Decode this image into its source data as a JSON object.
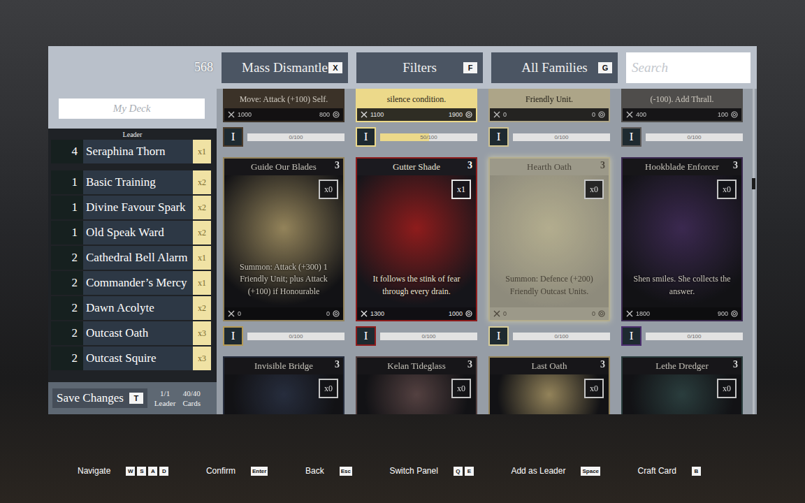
{
  "top_bar": {
    "currency": "568",
    "buttons": [
      {
        "label": "Mass Dismantle",
        "key": "X"
      },
      {
        "label": "Filters",
        "key": "F"
      },
      {
        "label": "All Families",
        "key": "G"
      }
    ],
    "search": {
      "placeholder": "Search"
    }
  },
  "deck": {
    "name_placeholder": "My Deck",
    "leader_label": "Leader",
    "leader": {
      "cost": "4",
      "name": "Seraphina Thorn",
      "count": "x1"
    },
    "cards": [
      {
        "cost": "1",
        "name": "Basic Training",
        "count": "x2"
      },
      {
        "cost": "1",
        "name": "Divine Favour Spark",
        "count": "x2"
      },
      {
        "cost": "1",
        "name": "Old Speak Ward",
        "count": "x2"
      },
      {
        "cost": "2",
        "name": "Cathedral Bell Alarm",
        "count": "x1"
      },
      {
        "cost": "2",
        "name": "Commander’s Mercy",
        "count": "x1"
      },
      {
        "cost": "2",
        "name": "Dawn Acolyte",
        "count": "x2"
      },
      {
        "cost": "2",
        "name": "Outcast Oath",
        "count": "x3"
      },
      {
        "cost": "2",
        "name": "Outcast Squire",
        "count": "x3"
      }
    ],
    "save": {
      "label": "Save Changes",
      "key": "T"
    },
    "leader_count": {
      "value": "1/1",
      "label": "Leader"
    },
    "card_count": {
      "value": "40/40",
      "label": "Cards"
    }
  },
  "cards": [
    {
      "kind": "partial",
      "text": "Move: Attack (+100) Self.",
      "attack": "1000",
      "defence": "800",
      "color": "#4a3a2a",
      "owned": false,
      "selected": false,
      "rank": "I",
      "progress": "0/100",
      "level": 0
    },
    {
      "kind": "partial",
      "text": "silence condition.",
      "attack": "1100",
      "defence": "1900",
      "color": "#ecd98a",
      "owned": true,
      "selected": false,
      "rank": "I",
      "progress": "50/100",
      "level": 0.5
    },
    {
      "kind": "partial",
      "text": "Friendly Unit.",
      "attack": "0",
      "defence": "0",
      "color": "#cfc391",
      "owned": false,
      "selected": false,
      "rank": "I",
      "progress": "0/100",
      "level": 0
    },
    {
      "kind": "partial",
      "text": "(-100). Add Thrall.",
      "attack": "400",
      "defence": "100",
      "color": "#5e5a58",
      "owned": false,
      "selected": false,
      "rank": "I",
      "progress": "0/100",
      "level": 0
    },
    {
      "kind": "full",
      "name": "Guide Our Blades",
      "cost": "3",
      "count": "x0",
      "text": "Summon: Attack (+300) 1 Friendly Unit; plus Attack (+100) if Honourable",
      "attack": "0",
      "defence": "0",
      "color": "#b59a55",
      "owned": false,
      "selected": false,
      "rank": "I",
      "progress": "0/100",
      "level": 0
    },
    {
      "kind": "full",
      "name": "Gutter Shade",
      "cost": "3",
      "count": "x1",
      "text": "It follows the stink of fear through every drain.",
      "attack": "1300",
      "defence": "1000",
      "color": "#8e1c1c",
      "owned": true,
      "selected": false,
      "rank": "I",
      "progress": "0/100",
      "level": 0
    },
    {
      "kind": "full",
      "name": "Hearth Oath",
      "cost": "3",
      "count": "x0",
      "text": "Summon: Defence (+200) Friendly Outcast Units.",
      "attack": "0",
      "defence": "0",
      "color": "#d6cc98",
      "owned": false,
      "selected": true,
      "rank": "I",
      "progress": "0/100",
      "level": 0
    },
    {
      "kind": "full",
      "name": "Hookblade Enforcer",
      "cost": "3",
      "count": "x0",
      "text": "Shen smiles. She collects the answer.",
      "attack": "1800",
      "defence": "900",
      "color": "#4b2d6e",
      "owned": false,
      "selected": false,
      "rank": "I",
      "progress": "0/100",
      "level": 0
    },
    {
      "kind": "top",
      "name": "Invisible Bridge",
      "cost": "3",
      "count": "x0",
      "color": "#2a3550",
      "owned": false,
      "selected": false
    },
    {
      "kind": "top",
      "name": "Kelan Tideglass",
      "cost": "3",
      "count": "x0",
      "color": "#6a4a4a",
      "owned": false,
      "selected": false
    },
    {
      "kind": "top",
      "name": "Last Oath",
      "cost": "3",
      "count": "x0",
      "color": "#b59a55",
      "owned": false,
      "selected": false
    },
    {
      "kind": "top",
      "name": "Lethe Dredger",
      "cost": "3",
      "count": "x0",
      "color": "#2a4a4a",
      "owned": false,
      "selected": false
    }
  ],
  "hints": [
    {
      "label": "Navigate",
      "keys": [
        "W",
        "S",
        "A",
        "D"
      ]
    },
    {
      "label": "Confirm",
      "keys": [
        "Enter"
      ]
    },
    {
      "label": "Back",
      "keys": [
        "Esc"
      ]
    },
    {
      "label": "Switch Panel",
      "keys": [
        "Q",
        "E"
      ]
    },
    {
      "label": "Add as Leader",
      "keys": [
        "Space"
      ]
    },
    {
      "label": "Craft Card",
      "keys": [
        "B"
      ]
    }
  ]
}
